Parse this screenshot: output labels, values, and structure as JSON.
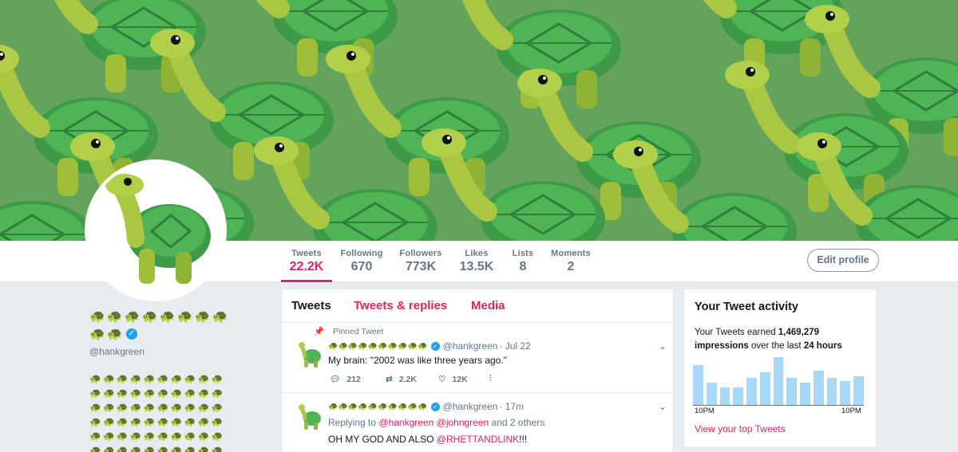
{
  "nav": {
    "stats": [
      {
        "label": "Tweets",
        "value": "22.2K",
        "active": true
      },
      {
        "label": "Following",
        "value": "670"
      },
      {
        "label": "Followers",
        "value": "773K"
      },
      {
        "label": "Likes",
        "value": "13.5K"
      },
      {
        "label": "Lists",
        "value": "8"
      },
      {
        "label": "Moments",
        "value": "2"
      }
    ],
    "edit_profile": "Edit profile"
  },
  "profile": {
    "name_emoji": "🐢",
    "handle": "@hankgreen"
  },
  "timeline": {
    "tabs": [
      "Tweets",
      "Tweets & replies",
      "Media"
    ],
    "tweets": [
      {
        "pinned_label": "Pinned Tweet",
        "handle": "@hankgreen",
        "time": "· Jul 22",
        "text": "My brain: \"2002 was like three years ago.\"",
        "replies": "212",
        "retweets": "2.2K",
        "likes": "12K"
      },
      {
        "handle": "@hankgreen",
        "time": "· 17m",
        "reply_prefix": "Replying to",
        "reply_to_1": "@hankgreen",
        "reply_to_2": "@johngreen",
        "reply_suffix": "and 2 others",
        "text_prefix": "OH MY GOD AND ALSO",
        "text_mention": "@RHETTANDLINK",
        "text_suffix": "!!!"
      }
    ]
  },
  "activity": {
    "title": "Your Tweet activity",
    "desc_prefix": "Your Tweets earned",
    "impressions": "1,469,279",
    "impressions_word": "impressions",
    "desc_middle": "over the last",
    "period": "24 hours",
    "axis_start": "10PM",
    "axis_end": "10PM",
    "link": "View your top Tweets",
    "bar_fractions": [
      0.78,
      0.44,
      0.34,
      0.34,
      0.53,
      0.64,
      0.94,
      0.53,
      0.44,
      0.67,
      0.53,
      0.47,
      0.56
    ]
  },
  "colors": {
    "accent": "#e0245e",
    "verified": "#1da1f2",
    "chart_bar": "#a7d8f7",
    "banner_bg": "#63a35c"
  }
}
